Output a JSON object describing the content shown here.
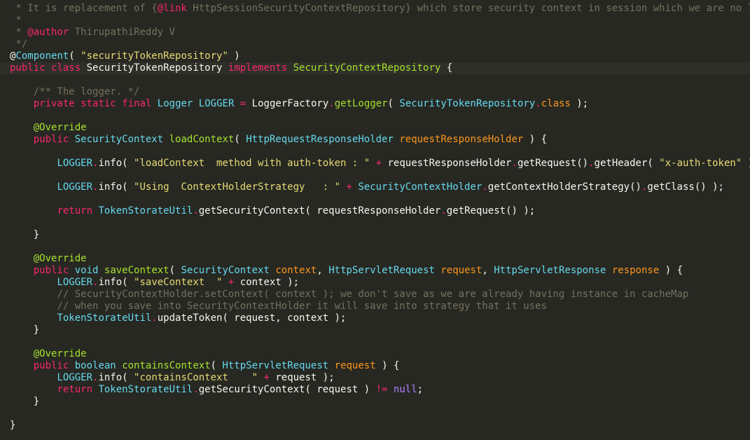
{
  "editor": {
    "colors": {
      "background": "#272822",
      "plain": "#f8f8f2",
      "keyword": "#f92672",
      "type": "#66d9ef",
      "string": "#e6db74",
      "comment": "#75715e",
      "param": "#fd971f",
      "method": "#a6e22e",
      "constant": "#ae81ff"
    },
    "lines": [
      {
        "tokens": [
          {
            "t": " * It is replacement of {",
            "c": "comment"
          },
          {
            "t": "@link",
            "c": "keyword"
          },
          {
            "t": " HttpSessionSecurityContextRepository} which store security context in session which we are no longer",
            "c": "comment"
          }
        ]
      },
      {
        "tokens": [
          {
            "t": " *",
            "c": "comment"
          }
        ]
      },
      {
        "tokens": [
          {
            "t": " * ",
            "c": "comment"
          },
          {
            "t": "@author",
            "c": "keyword"
          },
          {
            "t": " ThirupathiReddy V",
            "c": "comment"
          }
        ]
      },
      {
        "tokens": [
          {
            "t": " */",
            "c": "comment"
          }
        ]
      },
      {
        "tokens": [
          {
            "t": "@",
            "c": "plain"
          },
          {
            "t": "Component",
            "c": "type"
          },
          {
            "t": "( ",
            "c": "plain"
          },
          {
            "t": "\"securityTokenRepository\"",
            "c": "string"
          },
          {
            "t": " )",
            "c": "plain"
          }
        ]
      },
      {
        "active": true,
        "tokens": [
          {
            "t": "public",
            "c": "keyword"
          },
          {
            "t": " ",
            "c": "plain"
          },
          {
            "t": "class",
            "c": "keyword"
          },
          {
            "t": " SecurityTokenRepository ",
            "c": "plain"
          },
          {
            "t": "implements",
            "c": "keyword"
          },
          {
            "t": " ",
            "c": "plain"
          },
          {
            "t": "SecurityContextRepository",
            "c": "method"
          },
          {
            "t": " {",
            "c": "plain"
          }
        ]
      },
      {
        "tokens": []
      },
      {
        "tokens": [
          {
            "t": "    /** The logger. */",
            "c": "comment"
          }
        ]
      },
      {
        "tokens": [
          {
            "t": "    ",
            "c": "plain"
          },
          {
            "t": "private",
            "c": "keyword"
          },
          {
            "t": " ",
            "c": "plain"
          },
          {
            "t": "static",
            "c": "keyword"
          },
          {
            "t": " ",
            "c": "plain"
          },
          {
            "t": "final",
            "c": "keyword"
          },
          {
            "t": " ",
            "c": "plain"
          },
          {
            "t": "Logger",
            "c": "type"
          },
          {
            "t": " ",
            "c": "plain"
          },
          {
            "t": "LOGGER",
            "c": "type"
          },
          {
            "t": " = ",
            "c": "keyword"
          },
          {
            "t": "LoggerFactory",
            "c": "plain"
          },
          {
            "t": ".",
            "c": "keyword"
          },
          {
            "t": "getLogger",
            "c": "method"
          },
          {
            "t": "( ",
            "c": "plain"
          },
          {
            "t": "SecurityTokenRepository",
            "c": "type"
          },
          {
            "t": ".",
            "c": "keyword"
          },
          {
            "t": "class",
            "c": "param"
          },
          {
            "t": " );",
            "c": "plain"
          }
        ]
      },
      {
        "tokens": []
      },
      {
        "tokens": [
          {
            "t": "    @Override",
            "c": "method"
          }
        ]
      },
      {
        "tokens": [
          {
            "t": "    ",
            "c": "plain"
          },
          {
            "t": "public",
            "c": "keyword"
          },
          {
            "t": " ",
            "c": "plain"
          },
          {
            "t": "SecurityContext",
            "c": "type"
          },
          {
            "t": " ",
            "c": "plain"
          },
          {
            "t": "loadContext",
            "c": "method"
          },
          {
            "t": "( ",
            "c": "plain"
          },
          {
            "t": "HttpRequestResponseHolder",
            "c": "type"
          },
          {
            "t": " ",
            "c": "plain"
          },
          {
            "t": "requestResponseHolder",
            "c": "param"
          },
          {
            "t": " ) {",
            "c": "plain"
          }
        ]
      },
      {
        "tokens": []
      },
      {
        "tokens": [
          {
            "t": "        ",
            "c": "plain"
          },
          {
            "t": "LOGGER",
            "c": "type"
          },
          {
            "t": ".",
            "c": "keyword"
          },
          {
            "t": "info",
            "c": "plain"
          },
          {
            "t": "( ",
            "c": "plain"
          },
          {
            "t": "\"loadContext  method with auth-token : \"",
            "c": "string"
          },
          {
            "t": " + ",
            "c": "keyword"
          },
          {
            "t": "requestResponseHolder",
            "c": "plain"
          },
          {
            "t": ".",
            "c": "keyword"
          },
          {
            "t": "getRequest",
            "c": "plain"
          },
          {
            "t": "()",
            "c": "plain"
          },
          {
            "t": ".",
            "c": "keyword"
          },
          {
            "t": "getHeader",
            "c": "plain"
          },
          {
            "t": "( ",
            "c": "plain"
          },
          {
            "t": "\"x-auth-token\"",
            "c": "string"
          },
          {
            "t": " ) );",
            "c": "plain"
          }
        ]
      },
      {
        "tokens": []
      },
      {
        "tokens": [
          {
            "t": "        ",
            "c": "plain"
          },
          {
            "t": "LOGGER",
            "c": "type"
          },
          {
            "t": ".",
            "c": "keyword"
          },
          {
            "t": "info",
            "c": "plain"
          },
          {
            "t": "( ",
            "c": "plain"
          },
          {
            "t": "\"Using  ContextHolderStrategy   : \"",
            "c": "string"
          },
          {
            "t": " + ",
            "c": "keyword"
          },
          {
            "t": "SecurityContextHolder",
            "c": "type"
          },
          {
            "t": ".",
            "c": "keyword"
          },
          {
            "t": "getContextHolderStrategy",
            "c": "plain"
          },
          {
            "t": "()",
            "c": "plain"
          },
          {
            "t": ".",
            "c": "keyword"
          },
          {
            "t": "getClass",
            "c": "plain"
          },
          {
            "t": "() );",
            "c": "plain"
          }
        ]
      },
      {
        "tokens": []
      },
      {
        "tokens": [
          {
            "t": "        ",
            "c": "plain"
          },
          {
            "t": "return",
            "c": "keyword"
          },
          {
            "t": " ",
            "c": "plain"
          },
          {
            "t": "TokenStorateUtil",
            "c": "type"
          },
          {
            "t": ".",
            "c": "keyword"
          },
          {
            "t": "getSecurityContext",
            "c": "plain"
          },
          {
            "t": "( requestResponseHolder",
            "c": "plain"
          },
          {
            "t": ".",
            "c": "keyword"
          },
          {
            "t": "getRequest",
            "c": "plain"
          },
          {
            "t": "() );",
            "c": "plain"
          }
        ]
      },
      {
        "tokens": []
      },
      {
        "tokens": [
          {
            "t": "    }",
            "c": "plain"
          }
        ]
      },
      {
        "tokens": []
      },
      {
        "tokens": [
          {
            "t": "    @Override",
            "c": "method"
          }
        ]
      },
      {
        "tokens": [
          {
            "t": "    ",
            "c": "plain"
          },
          {
            "t": "public",
            "c": "keyword"
          },
          {
            "t": " ",
            "c": "plain"
          },
          {
            "t": "void",
            "c": "type"
          },
          {
            "t": " ",
            "c": "plain"
          },
          {
            "t": "saveContext",
            "c": "method"
          },
          {
            "t": "( ",
            "c": "plain"
          },
          {
            "t": "SecurityContext",
            "c": "type"
          },
          {
            "t": " ",
            "c": "plain"
          },
          {
            "t": "context",
            "c": "param"
          },
          {
            "t": ", ",
            "c": "plain"
          },
          {
            "t": "HttpServletRequest",
            "c": "type"
          },
          {
            "t": " ",
            "c": "plain"
          },
          {
            "t": "request",
            "c": "param"
          },
          {
            "t": ", ",
            "c": "plain"
          },
          {
            "t": "HttpServletResponse",
            "c": "type"
          },
          {
            "t": " ",
            "c": "plain"
          },
          {
            "t": "response",
            "c": "param"
          },
          {
            "t": " ) {",
            "c": "plain"
          }
        ]
      },
      {
        "tokens": [
          {
            "t": "        ",
            "c": "plain"
          },
          {
            "t": "LOGGER",
            "c": "type"
          },
          {
            "t": ".",
            "c": "keyword"
          },
          {
            "t": "info",
            "c": "plain"
          },
          {
            "t": "( ",
            "c": "plain"
          },
          {
            "t": "\"saveContext  \"",
            "c": "string"
          },
          {
            "t": " + ",
            "c": "keyword"
          },
          {
            "t": "context );",
            "c": "plain"
          }
        ]
      },
      {
        "tokens": [
          {
            "t": "        // SecurityContextHolder.setContext( context ); we don't save as we are already having instance in cacheMap",
            "c": "comment"
          }
        ]
      },
      {
        "tokens": [
          {
            "t": "        // when you save into SecurityContextHolder it will save into strategy that it uses",
            "c": "comment"
          }
        ]
      },
      {
        "tokens": [
          {
            "t": "        ",
            "c": "plain"
          },
          {
            "t": "TokenStorateUtil",
            "c": "type"
          },
          {
            "t": ".",
            "c": "keyword"
          },
          {
            "t": "updateToken",
            "c": "plain"
          },
          {
            "t": "( request, context );",
            "c": "plain"
          }
        ]
      },
      {
        "tokens": [
          {
            "t": "    }",
            "c": "plain"
          }
        ]
      },
      {
        "tokens": []
      },
      {
        "tokens": [
          {
            "t": "    @Override",
            "c": "method"
          }
        ]
      },
      {
        "tokens": [
          {
            "t": "    ",
            "c": "plain"
          },
          {
            "t": "public",
            "c": "keyword"
          },
          {
            "t": " ",
            "c": "plain"
          },
          {
            "t": "boolean",
            "c": "type"
          },
          {
            "t": " ",
            "c": "plain"
          },
          {
            "t": "containsContext",
            "c": "method"
          },
          {
            "t": "( ",
            "c": "plain"
          },
          {
            "t": "HttpServletRequest",
            "c": "type"
          },
          {
            "t": " ",
            "c": "plain"
          },
          {
            "t": "request",
            "c": "param"
          },
          {
            "t": " ) {",
            "c": "plain"
          }
        ]
      },
      {
        "tokens": [
          {
            "t": "        ",
            "c": "plain"
          },
          {
            "t": "LOGGER",
            "c": "type"
          },
          {
            "t": ".",
            "c": "keyword"
          },
          {
            "t": "info",
            "c": "plain"
          },
          {
            "t": "( ",
            "c": "plain"
          },
          {
            "t": "\"containsContext    \"",
            "c": "string"
          },
          {
            "t": " + ",
            "c": "keyword"
          },
          {
            "t": "request );",
            "c": "plain"
          }
        ]
      },
      {
        "tokens": [
          {
            "t": "        ",
            "c": "plain"
          },
          {
            "t": "return",
            "c": "keyword"
          },
          {
            "t": " ",
            "c": "plain"
          },
          {
            "t": "TokenStorateUtil",
            "c": "type"
          },
          {
            "t": ".",
            "c": "keyword"
          },
          {
            "t": "getSecurityContext",
            "c": "plain"
          },
          {
            "t": "( request ) ",
            "c": "plain"
          },
          {
            "t": "!=",
            "c": "keyword"
          },
          {
            "t": " ",
            "c": "plain"
          },
          {
            "t": "null",
            "c": "constant"
          },
          {
            "t": ";",
            "c": "plain"
          }
        ]
      },
      {
        "tokens": [
          {
            "t": "    }",
            "c": "plain"
          }
        ]
      },
      {
        "tokens": []
      },
      {
        "tokens": [
          {
            "t": "}",
            "c": "plain"
          }
        ]
      }
    ]
  }
}
